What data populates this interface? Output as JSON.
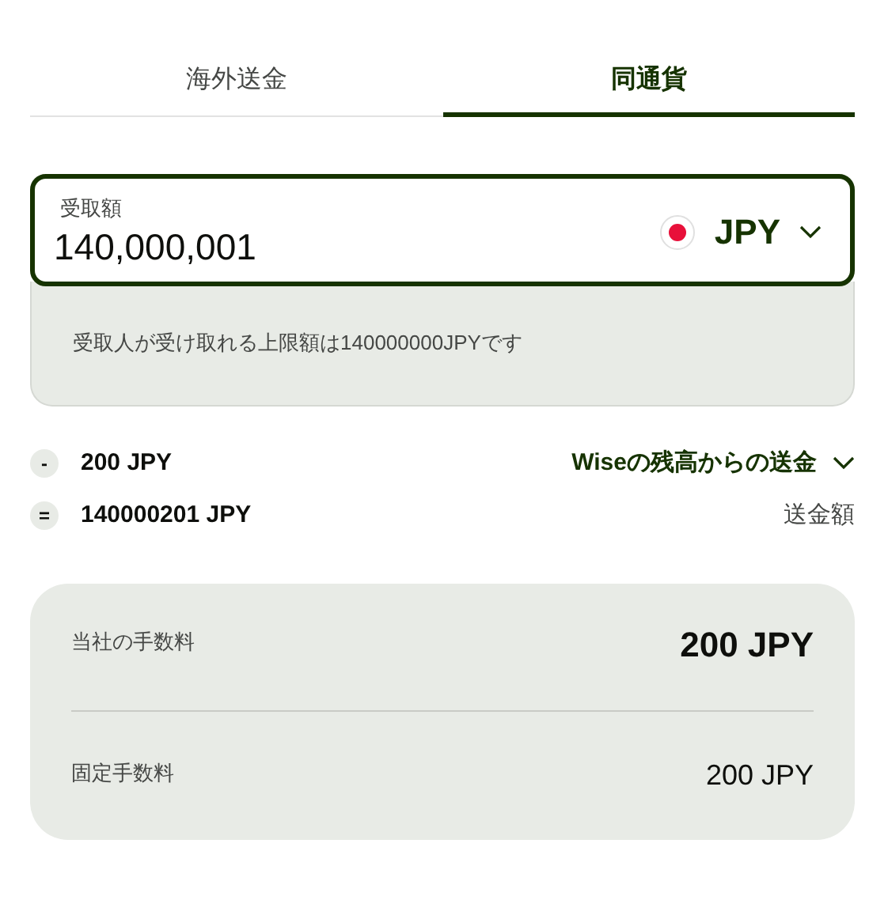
{
  "tabs": [
    {
      "label": "海外送金",
      "selected": false
    },
    {
      "label": "同通貨",
      "selected": true
    }
  ],
  "amount_field": {
    "label": "受取額",
    "value": "140,000,001",
    "currency": "JPY",
    "focused": true
  },
  "notice": "受取人が受け取れる上限額は140000000JPYです",
  "breakdown": [
    {
      "symbol": "-",
      "amount": "200 JPY",
      "label": "Wiseの残高からの送金",
      "kind": "dropdown"
    },
    {
      "symbol": "=",
      "amount": "140000201 JPY",
      "label": "送金額",
      "kind": "text"
    }
  ],
  "fees": [
    {
      "label": "当社の手数料",
      "value": "200 JPY",
      "kind": "total"
    },
    {
      "label": "固定手数料",
      "value": "200 JPY",
      "kind": "item"
    }
  ]
}
